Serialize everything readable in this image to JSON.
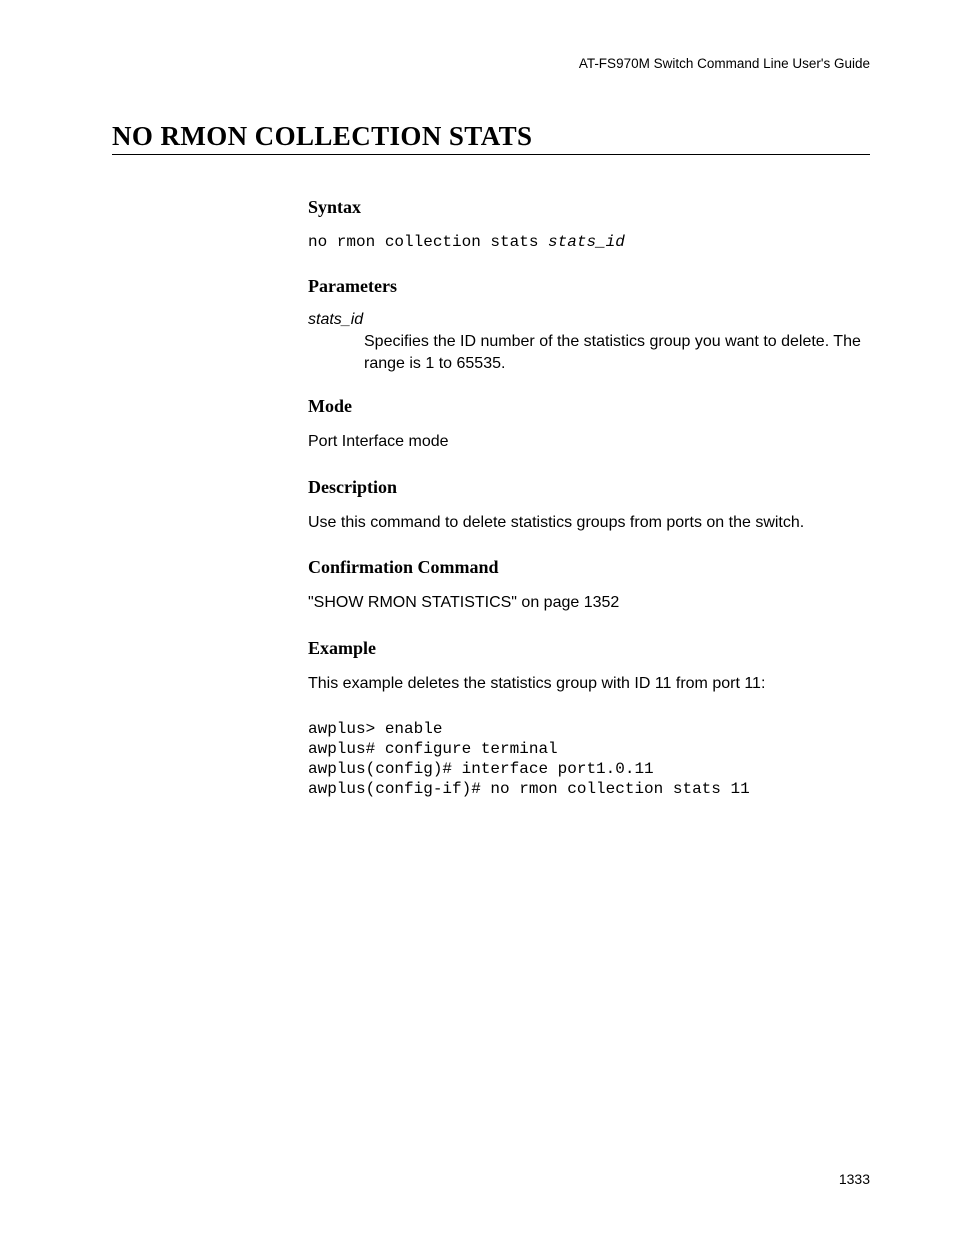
{
  "header": {
    "running_title": "AT-FS970M Switch Command Line User's Guide"
  },
  "title": "NO RMON COLLECTION STATS",
  "sections": {
    "syntax": {
      "heading": "Syntax",
      "command_prefix": "no rmon collection stats ",
      "command_arg": "stats_id"
    },
    "parameters": {
      "heading": "Parameters",
      "param_name": "stats_id",
      "param_desc": "Specifies the ID number of the statistics group you want to delete. The range is 1 to 65535."
    },
    "mode": {
      "heading": "Mode",
      "text": "Port Interface mode"
    },
    "description": {
      "heading": "Description",
      "text": "Use this command to delete statistics groups from ports on the switch."
    },
    "confirmation": {
      "heading": "Confirmation Command",
      "text": "\"SHOW RMON STATISTICS\" on page 1352"
    },
    "example": {
      "heading": "Example",
      "intro": "This example deletes the statistics group with ID 11 from port 11:",
      "code": "awplus> enable\nawplus# configure terminal\nawplus(config)# interface port1.0.11\nawplus(config-if)# no rmon collection stats 11"
    }
  },
  "page_number": "1333"
}
